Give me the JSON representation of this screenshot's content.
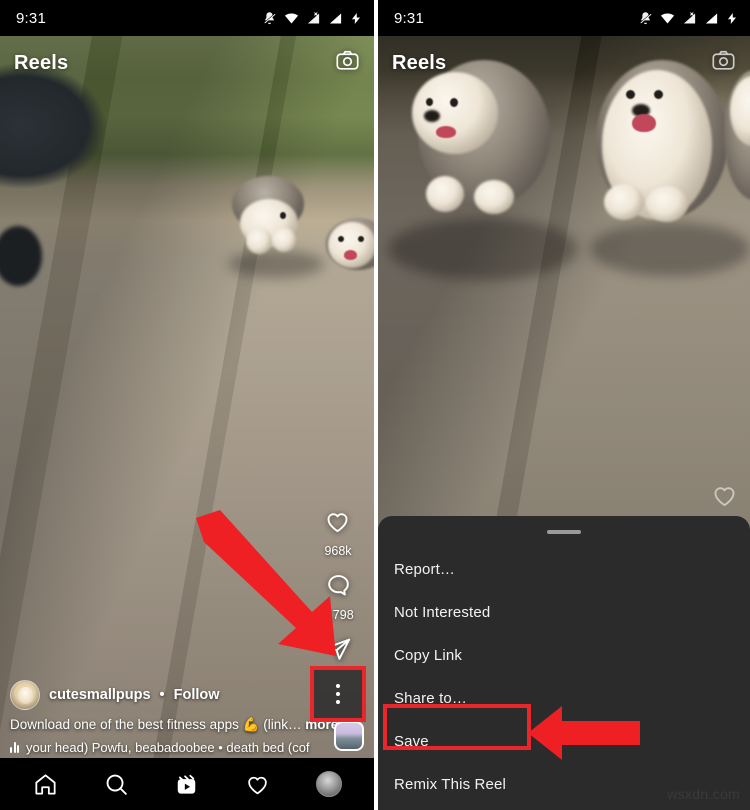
{
  "status_bar": {
    "time": "9:31",
    "icons": [
      "bell-muted-icon",
      "wifi-icon",
      "signal-no-sim-icon",
      "signal-icon",
      "battery-charging-icon"
    ]
  },
  "left_panel": {
    "header": {
      "title": "Reels",
      "camera_label": "camera-icon"
    },
    "actions": {
      "like_count": "968k",
      "comment_count": "9,798",
      "share_label": "share-icon",
      "more_label": "more-options-icon"
    },
    "caption": {
      "username": "cutesmallpups",
      "separator": "•",
      "follow_label": "Follow",
      "text": "Download one of the best fitness apps 💪 (link…",
      "more_label": "more",
      "audio": "your head)   Powfu, beabadoobee • death bed (cof"
    },
    "bottom_nav": [
      {
        "name": "home",
        "label": "home-icon"
      },
      {
        "name": "search",
        "label": "search-icon"
      },
      {
        "name": "reels",
        "label": "reels-icon"
      },
      {
        "name": "activity",
        "label": "heart-icon"
      },
      {
        "name": "profile",
        "label": "profile-avatar"
      }
    ]
  },
  "right_panel": {
    "header": {
      "title": "Reels",
      "camera_label": "camera-icon"
    },
    "sheet": {
      "handle_label": "drag-handle",
      "items": [
        {
          "label": "Report…",
          "highlighted": false
        },
        {
          "label": "Not Interested",
          "highlighted": false
        },
        {
          "label": "Copy Link",
          "highlighted": false
        },
        {
          "label": "Share to…",
          "highlighted": false
        },
        {
          "label": "Save",
          "highlighted": true
        },
        {
          "label": "Remix This Reel",
          "highlighted": false
        }
      ]
    }
  },
  "annotations": {
    "arrow_color": "#ee2024",
    "highlight_color": "#e8262b",
    "left_arrow_target": "more-options-icon",
    "right_arrow_target": "Save"
  },
  "watermark": {
    "text": "wsxdn.com"
  },
  "colors": {
    "sheet_background": "#2b2b2b",
    "status_background": "#000000",
    "text_primary": "#ffffff",
    "accent_red": "#e8262b"
  }
}
